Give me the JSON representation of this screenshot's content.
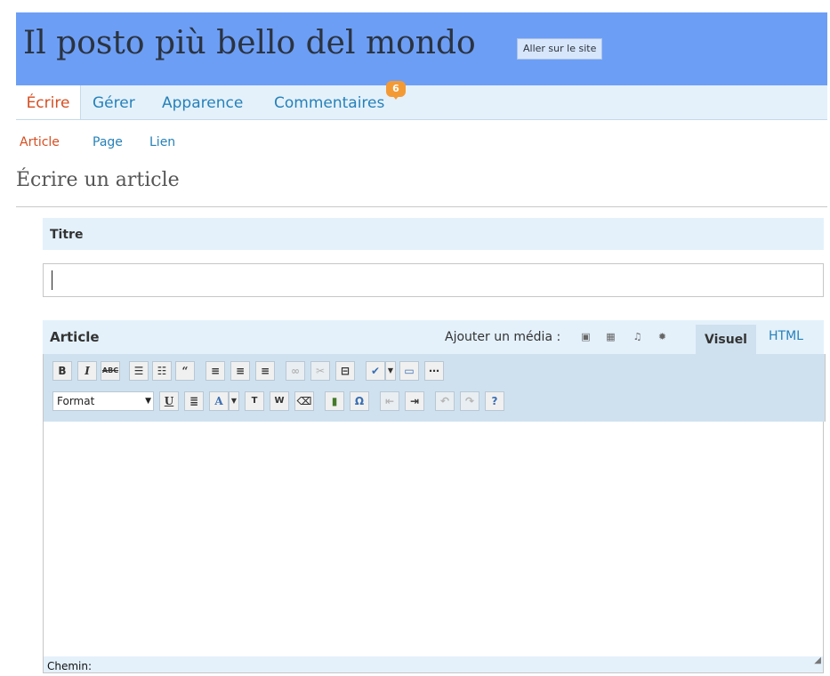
{
  "header": {
    "site_title": "Il posto più bello del mondo",
    "visit_site": "Aller sur le site",
    "bg_color": "#6d9ef5"
  },
  "menu": {
    "items": [
      {
        "label": "Écrire",
        "active": true
      },
      {
        "label": "Gérer"
      },
      {
        "label": "Apparence"
      },
      {
        "label": "Commentaires",
        "badge": "6"
      }
    ]
  },
  "submenu": {
    "items": [
      {
        "label": "Article",
        "active": true
      },
      {
        "label": "Page"
      },
      {
        "label": "Lien"
      }
    ]
  },
  "page": {
    "title": "Écrire un article"
  },
  "title_box": {
    "label": "Titre",
    "value": ""
  },
  "editor": {
    "label": "Article",
    "add_media": "Ajouter un média :",
    "media_icons": [
      "image-icon",
      "gallery-icon",
      "audio-icon",
      "media-icon"
    ],
    "tabs": [
      {
        "label": "Visuel",
        "active": true
      },
      {
        "label": "HTML"
      }
    ],
    "format_select": "Format",
    "toolbar_row1_icons": [
      "bold-icon",
      "italic-icon",
      "strikethrough-icon",
      "bullet-list-icon",
      "numbered-list-icon",
      "blockquote-icon",
      "align-left-icon",
      "align-center-icon",
      "align-right-icon",
      "link-icon",
      "unlink-icon",
      "more-icon",
      "spellcheck-icon",
      "dropdown-icon",
      "fullscreen-icon",
      "kitchen-sink-icon"
    ],
    "toolbar_row2_icons": [
      "underline-icon",
      "justify-icon",
      "text-color-icon",
      "dropdown-icon",
      "paste-text-icon",
      "paste-word-icon",
      "remove-format-icon",
      "media-embed-icon",
      "special-char-icon",
      "outdent-icon",
      "indent-icon",
      "undo-icon",
      "redo-icon",
      "help-icon"
    ],
    "path_label": "Chemin:"
  },
  "colors": {
    "accent": "#d54e21",
    "link": "#2681b8",
    "panel": "#e4f1fb"
  }
}
